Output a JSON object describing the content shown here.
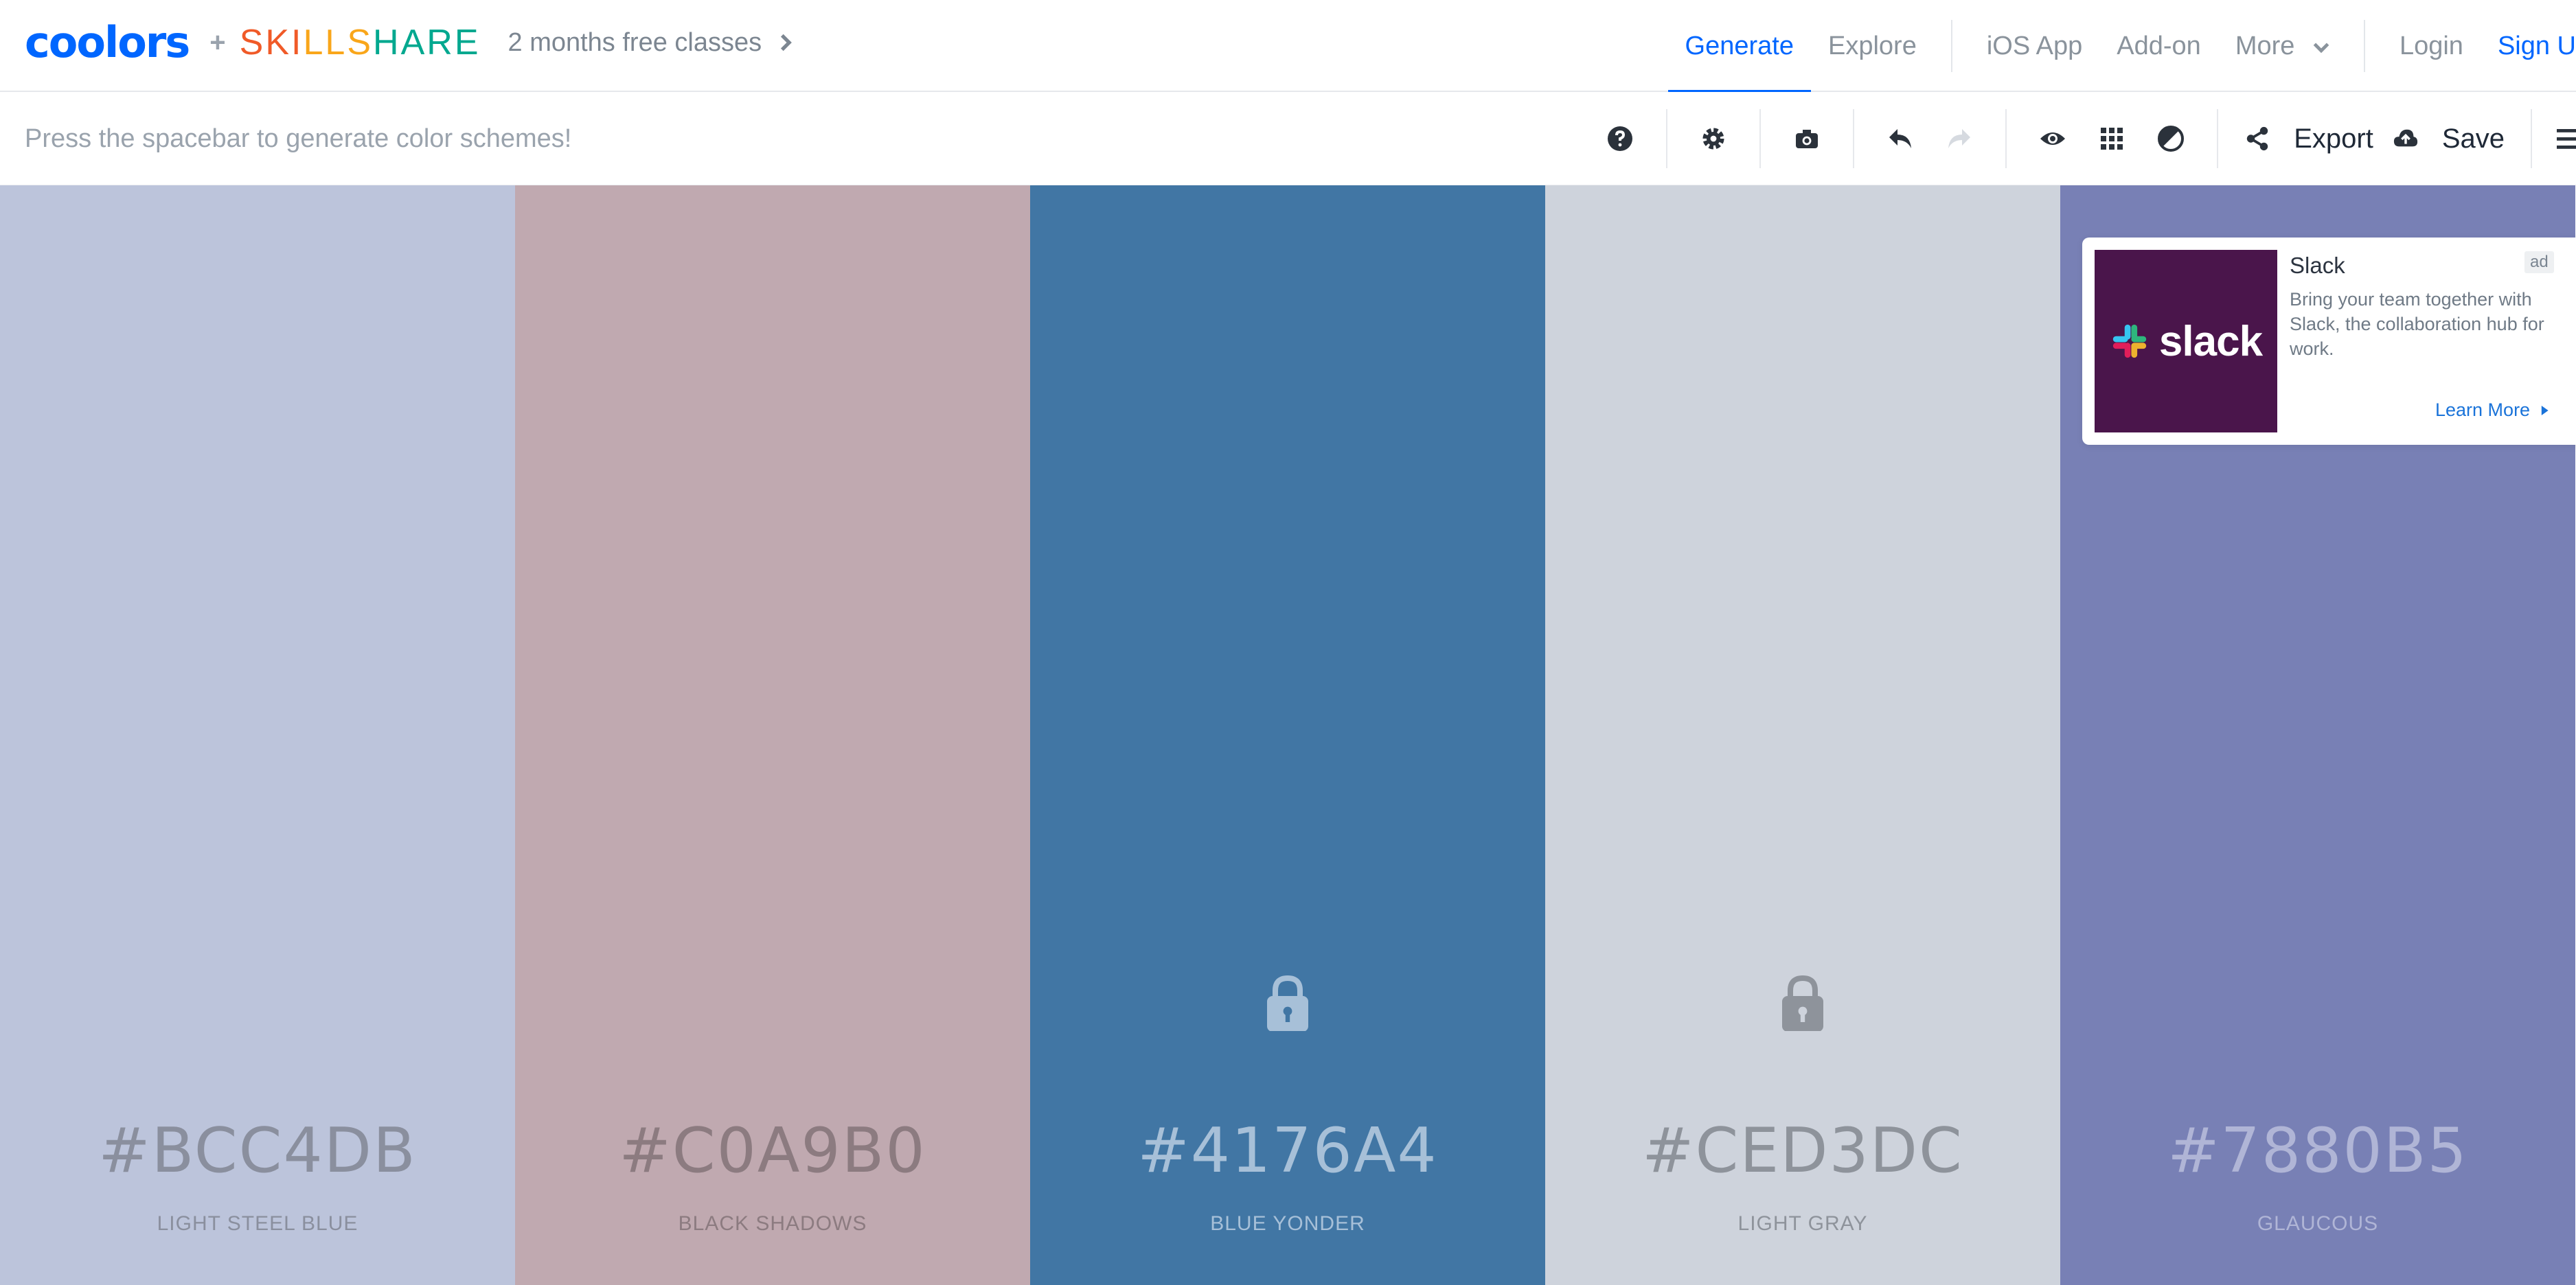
{
  "header": {
    "logo_coolors": "coolors",
    "plus": "+",
    "logo_skillshare_letters": [
      "S",
      "K",
      "I",
      "L",
      "L",
      "S",
      "H",
      "A",
      "R",
      "E"
    ],
    "skillshare_colors": [
      "#f05a28",
      "#f05a28",
      "#f05a28",
      "#f9a61a",
      "#f9a61a",
      "#f9a61a",
      "#00a88f",
      "#00a88f",
      "#00a88f",
      "#00a88f"
    ],
    "promo_text": "2 months free classes",
    "nav": {
      "generate": "Generate",
      "explore": "Explore",
      "ios_app": "iOS App",
      "addon": "Add-on",
      "more": "More",
      "login": "Login",
      "signup": "Sign U"
    },
    "accent_color": "#0066ff"
  },
  "toolbar": {
    "hint": "Press the spacebar to generate color schemes!",
    "export_label": "Export",
    "save_label": "Save",
    "icons": [
      "help-icon",
      "settings-icon",
      "camera-icon",
      "undo-icon",
      "redo-icon",
      "view-icon",
      "grid-icon",
      "contrast-icon",
      "share-icon",
      "cloud-upload-icon",
      "menu-icon"
    ]
  },
  "palette": [
    {
      "hex": "#BCC4DB",
      "name": "LIGHT STEEL BLUE",
      "locked": false,
      "text_color": "#8a8f9e"
    },
    {
      "hex": "#C0A9B0",
      "name": "BLACK SHADOWS",
      "locked": false,
      "text_color": "#8c7b80"
    },
    {
      "hex": "#4176A4",
      "name": "BLUE YONDER",
      "locked": true,
      "text_color": "#a7c0d8"
    },
    {
      "hex": "#CED3DC",
      "name": "LIGHT GRAY",
      "locked": true,
      "text_color": "#8e939b"
    },
    {
      "hex": "#7880B5",
      "name": "GLAUCOUS",
      "locked": false,
      "text_color": "#b0b5d6"
    }
  ],
  "ad": {
    "brand_word": "slack",
    "title": "Slack",
    "badge": "ad",
    "description": "Bring your team together with Slack, the collaboration hub for work.",
    "cta": "Learn More",
    "image_bg": "#4a154b"
  }
}
